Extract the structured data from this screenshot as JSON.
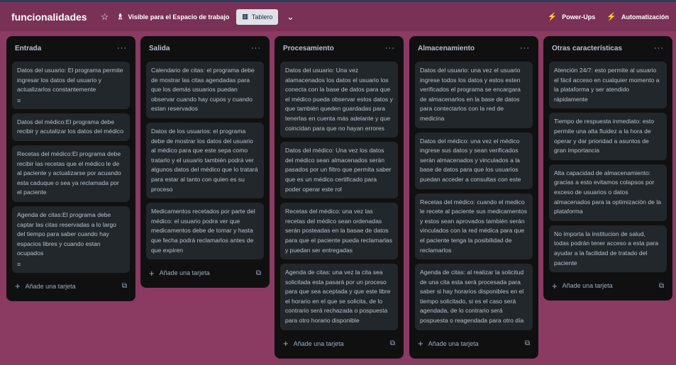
{
  "board": {
    "title": "funcionalidades",
    "star_icon": "☆",
    "visibility_icon": "♗",
    "visibility_label": "Visible para el Espacio de trabajo",
    "view_icon": "▥",
    "view_label": "Tablero",
    "chevron_icon": "⌄",
    "powerups_icon": "⚡",
    "powerups_label": "Power-Ups",
    "automation_icon": "⚡",
    "automation_label": "Automatización"
  },
  "colors": {
    "board_bg": "#8b3a62",
    "list_bg": "#101010",
    "card_bg": "#22272b",
    "text": "#b6c2cf"
  },
  "common": {
    "menu_icon": "···",
    "add_icon": "+",
    "add_label": "Añade una tarjeta",
    "template_icon": "⧉",
    "desc_icon": "≡"
  },
  "lists": [
    {
      "title": "Entrada",
      "cards": [
        "Datos del usuario: El programa permite ingresar los datos del usuario y actualizarlos constantemente",
        "Datos del médico:El programa debe recibir y acutalizar los datos del médico",
        "Recetas del médico:El programa debe recibir las recetas que el médico le de al paciente y actualizarse por acuando esta caduque o sea ya reclamada por el paciente",
        "Agenda de citas:El programa debe captar las citas reservadas a lo largo del tiempo para saber cuando hay espacios libres y cuando estan ocupados"
      ]
    },
    {
      "title": "Salida",
      "cards": [
        "Calendario de citas: el programa debe de mostrar las citas agendadas para que los demás usuarios puedan observar cuando hay cupos y cuando estan reservados",
        "Datos de los usuarios: el programa debe de mostrar los datos del usuario al médico para que este sepa como tratarlo y el usuario también podrá ver algunos datos del médico que lo tratará para estar al tanto con quien es su proceso",
        "Medicamentos recetados por parte del médico: el usuario podra ver que medicamentos debe de tomar y hasta que fecha podrá reclamarlos antes de que expiren"
      ]
    },
    {
      "title": "Procesamiento",
      "cards": [
        "Datos del usuario: Una vez alamacenados los datos el usuario los conecta con la base de datos para que el médico pueda observar estos datos y que también queden guardadas para tenerlas en cuenta más adelante y que coincidan para que no hayan errores",
        "Datos del médico: Una vez los datos del médico sean almacenados serán pasados por un filtro que permita saber que es un médico certificado para poder operar este rol",
        "Recetas del médico: una vez las recetas del médico sean ordenadas serán posteadas en la basae de datos para que el paciente pueda reclamarlas y puedan ser entregadas",
        "Agenda de citas: una vez la cita sea solicitada esta pasará por un proceso para que sea aceptada y que este libre el horario en el que se solicita, de lo contrario será rechazada o pospuesta para otro horario disponible"
      ]
    },
    {
      "title": "Almacenamiento",
      "cards": [
        "Datos del usuario: una vez el usuario ingrese todos los datos y estos esten verificados el programa se encargara de almacenarlos en la base de datos para contectarlos con la red de medicina",
        "Datos del médico: una vez el médico ingrese sus datos y sean verificados serán almacenados y vinculados a la base de datos para que los usuarios puedan acceder a consultas con este",
        "Recetas del médico: cuando el medico le recete al paciente sus medicamentos y estos sean aprovados también serán vinculados con la red médica para que el paciente tenga la posibilidad de reclamarlos",
        "Agenda de citas: al realizar la solicitud de una cita esta será procesada para saber si hay horarios disponibles en el tiempo solicitado, si es el caso será agendada, de lo contrario será pospuesta o reagendada para otro día"
      ]
    },
    {
      "title": "Otras características",
      "cards": [
        "Atención 24/7: esto permite al usuario el fácil acceso en cualquier momento a la plataforma y ser atendido rápidamente",
        "Tiempo de respuesta inmediato: esto permite una alta fluidez a la hora de operar y dar prioridad a asuntos de gran importancia",
        "Alta capacidad de almacenamiento: gracias a esto evitamos colapsos por exceso de usuarios o datos almacenados para la optimización de la plataforma",
        "No importa la institucion de salud, todas podrán tener acceso a esta para ayudar a la facilidad de tratado del paciente"
      ]
    }
  ]
}
